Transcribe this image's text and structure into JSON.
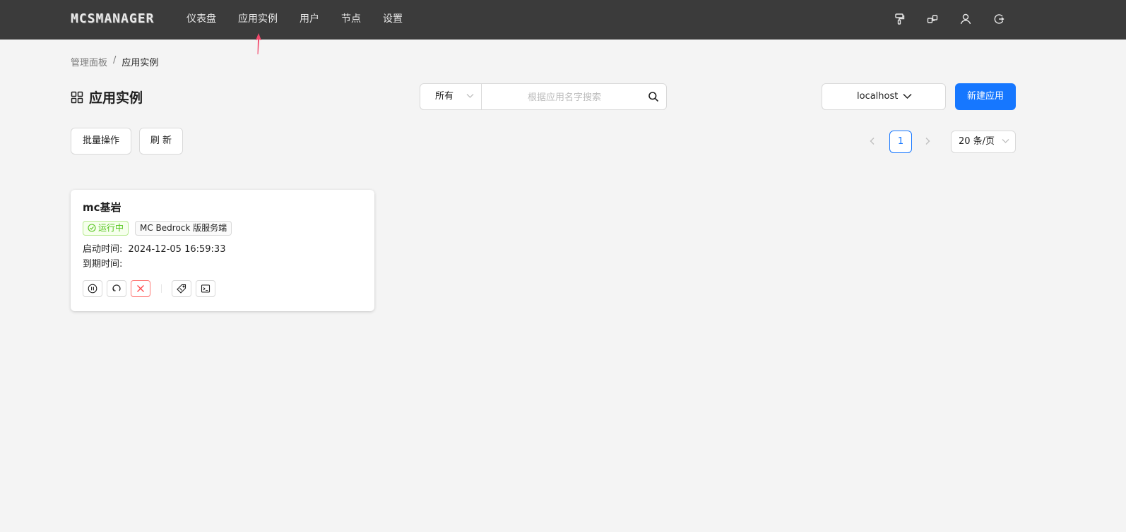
{
  "app": {
    "logo_text": "MCSMANAGER"
  },
  "nav": {
    "items": [
      {
        "label": "仪表盘"
      },
      {
        "label": "应用实例"
      },
      {
        "label": "用户"
      },
      {
        "label": "节点"
      },
      {
        "label": "设置"
      }
    ],
    "right_icons": [
      "theme-brush-icon",
      "nodes-icon",
      "user-icon",
      "logout-icon"
    ]
  },
  "breadcrumb": {
    "root": "管理面板",
    "separator": "/",
    "current": "应用实例"
  },
  "page": {
    "title": "应用实例",
    "title_icon": "grid-icon"
  },
  "search": {
    "filter_value": "所有",
    "placeholder": "根据应用名字搜索"
  },
  "node_select": {
    "value": "localhost"
  },
  "buttons": {
    "new_app": "新建应用",
    "batch": "批量操作",
    "refresh": "刷 新"
  },
  "pagination": {
    "current_page": "1",
    "page_size": "20 条/页"
  },
  "instances": [
    {
      "name": "mc基岩",
      "status": "运行中",
      "type": "MC Bedrock 版服务端",
      "start_label": "启动时间:",
      "start_time": "2024-12-05 16:59:33",
      "expire_label": "到期时间:",
      "expire_time": "",
      "actions": [
        "pause-icon",
        "restart-icon",
        "kill-icon",
        "tag-icon",
        "terminal-icon"
      ]
    }
  ],
  "colors": {
    "topbar": "#3b3b3b",
    "primary": "#1677ff",
    "status_green": "#52c41a",
    "danger": "#ff4d4f",
    "annotation_arrow": "#f2486b"
  }
}
